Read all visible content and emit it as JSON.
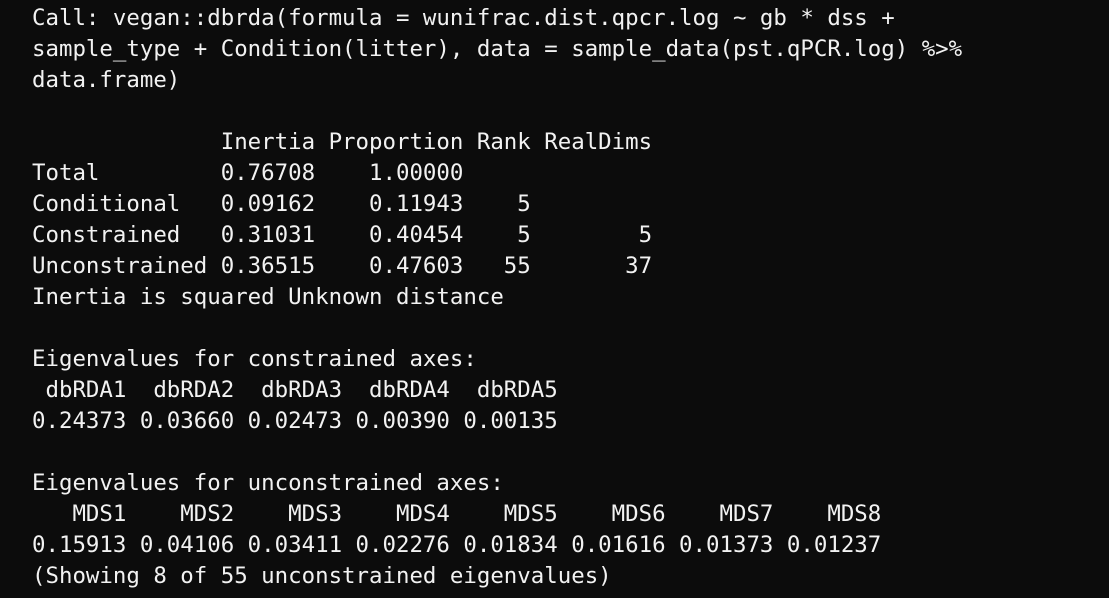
{
  "terminal": {
    "lines": [
      "Call: vegan::dbrda(formula = wunifrac.dist.qpcr.log ~ gb * dss +",
      "sample_type + Condition(litter), data = sample_data(pst.qPCR.log) %>%",
      "data.frame)",
      "",
      "              Inertia Proportion Rank RealDims",
      "Total         0.76708    1.00000",
      "Conditional   0.09162    0.11943    5",
      "Constrained   0.31031    0.40454    5        5",
      "Unconstrained 0.36515    0.47603   55       37",
      "Inertia is squared Unknown distance",
      "",
      "Eigenvalues for constrained axes:",
      " dbRDA1  dbRDA2  dbRDA3  dbRDA4  dbRDA5",
      "0.24373 0.03660 0.02473 0.00390 0.00135",
      "",
      "Eigenvalues for unconstrained axes:",
      "   MDS1    MDS2    MDS3    MDS4    MDS5    MDS6    MDS7    MDS8",
      "0.15913 0.04106 0.03411 0.02276 0.01834 0.01616 0.01373 0.01237",
      "(Showing 8 of 55 unconstrained eigenvalues)"
    ]
  }
}
